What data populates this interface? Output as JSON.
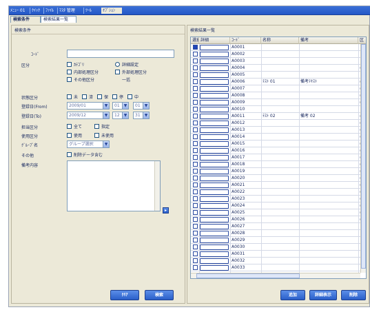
{
  "nav": {
    "items": [
      "ﾒﾆｭｰ 01",
      "ｸｲｯｸ",
      "ﾌｧｲﾙ",
      "ﾏｽﾀ 管理",
      "ﾂｰﾙ",
      "ｵﾌﾟｼｮﾝ"
    ]
  },
  "tabs": [
    "検索条件",
    "検索結果一覧"
  ],
  "left": {
    "title": "検索条件",
    "fields": [
      {
        "label": "ｺｰﾄﾞ",
        "value": ""
      },
      {
        "label": "区分"
      },
      {
        "label": "状態区分"
      },
      {
        "label": "登録日(From)"
      },
      {
        "label": "登録日(To)"
      },
      {
        "label": "担当区分"
      },
      {
        "label": "使用区分"
      },
      {
        "label": "ｸﾞﾙｰﾌﾟ名"
      },
      {
        "label": "その他"
      },
      {
        "label": "備考内容"
      }
    ],
    "kubun_options": [
      "ｶﾃｺﾞﾘ",
      "詳細設定",
      "内部処理区分",
      "外部処理区分",
      "その他区分",
      "一括"
    ],
    "status_options": [
      "未",
      "済",
      "保",
      "停",
      "中"
    ],
    "date_from": {
      "year": "2009/01",
      "month": "01",
      "day": "01"
    },
    "date_to": {
      "year": "2009/12",
      "month": "12",
      "day": "31"
    },
    "tanto_options": [
      "全て",
      "指定"
    ],
    "shiyo_options": [
      "使用",
      "未使用"
    ],
    "group_value": "グループ選択",
    "other_check_label": "削除データ含む",
    "buttons": {
      "search": "ｸﾘｱ",
      "clear": "検索"
    }
  },
  "right": {
    "title": "検索結果一覧",
    "columns": [
      "選択",
      "詳細",
      "ｺｰﾄﾞ",
      "名称",
      "備考",
      "区"
    ],
    "rows": [
      {
        "code": "A0001",
        "name": "",
        "note": "",
        "k": "",
        "sel": true
      },
      {
        "code": "A0002",
        "name": "",
        "note": "",
        "k": ""
      },
      {
        "code": "A0003",
        "name": "",
        "note": "",
        "k": ""
      },
      {
        "code": "A0004",
        "name": "",
        "note": "",
        "k": "○"
      },
      {
        "code": "A0005",
        "name": "",
        "note": "",
        "k": ""
      },
      {
        "code": "A0006",
        "name": "ﾃｽﾄ 01",
        "note": "備考ﾃｷｽﾄ",
        "k": "○○"
      },
      {
        "code": "A0007",
        "name": "",
        "note": "",
        "k": "○"
      },
      {
        "code": "A0008",
        "name": "",
        "note": "",
        "k": "○"
      },
      {
        "code": "A0009",
        "name": "",
        "note": "",
        "k": "○"
      },
      {
        "code": "A0010",
        "name": "",
        "note": "",
        "k": ""
      },
      {
        "code": "A0011",
        "name": "ﾃｽﾄ 02",
        "note": "備考 02",
        "k": "○○"
      },
      {
        "code": "A0012",
        "name": "",
        "note": "",
        "k": "○○"
      },
      {
        "code": "A0013",
        "name": "",
        "note": "",
        "k": "○"
      },
      {
        "code": "A0014",
        "name": "",
        "note": "",
        "k": "○"
      },
      {
        "code": "A0015",
        "name": "",
        "note": "",
        "k": "○"
      },
      {
        "code": "A0016",
        "name": "",
        "note": "",
        "k": "○"
      },
      {
        "code": "A0017",
        "name": "",
        "note": "",
        "k": "○"
      },
      {
        "code": "A0018",
        "name": "",
        "note": "",
        "k": "○"
      },
      {
        "code": "A0019",
        "name": "",
        "note": "",
        "k": "○"
      },
      {
        "code": "A0020",
        "name": "",
        "note": "",
        "k": "○"
      },
      {
        "code": "A0021",
        "name": "",
        "note": "",
        "k": "○○"
      },
      {
        "code": "A0022",
        "name": "",
        "note": "",
        "k": "○○"
      },
      {
        "code": "A0023",
        "name": "",
        "note": "",
        "k": "○"
      },
      {
        "code": "A0024",
        "name": "",
        "note": "",
        "k": "○"
      },
      {
        "code": "A0025",
        "name": "",
        "note": "",
        "k": "○○"
      },
      {
        "code": "A0026",
        "name": "",
        "note": "",
        "k": "○"
      },
      {
        "code": "A0027",
        "name": "",
        "note": "",
        "k": ""
      },
      {
        "code": "A0028",
        "name": "",
        "note": "",
        "k": ""
      },
      {
        "code": "A0029",
        "name": "",
        "note": "",
        "k": ""
      },
      {
        "code": "A0030",
        "name": "",
        "note": "",
        "k": ""
      },
      {
        "code": "A0031",
        "name": "",
        "note": "",
        "k": ""
      },
      {
        "code": "A0032",
        "name": "",
        "note": "",
        "k": ""
      },
      {
        "code": "A0033",
        "name": "",
        "note": "",
        "k": ""
      }
    ],
    "buttons": {
      "add": "追加",
      "edit": "詳細表示",
      "delete": "削除"
    }
  },
  "colors": {
    "accent": "#2a5fc9",
    "panel": "#ece9d8",
    "border": "#7f9db9"
  }
}
